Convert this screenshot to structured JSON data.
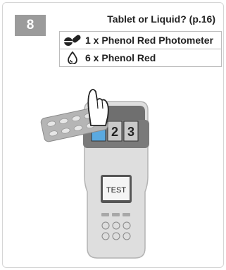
{
  "step": {
    "number": "8"
  },
  "header": {
    "title": "Tablet or Liquid? (p.16)"
  },
  "reagents": [
    {
      "icon": "tablet-icon",
      "text": "1 x Phenol Red Photometer"
    },
    {
      "icon": "drop-icon",
      "text": "6 x Phenol Red"
    }
  ],
  "illustration": {
    "display_text": "TEST",
    "cell_labels": [
      "2",
      "3"
    ],
    "icons": [
      "hand-icon",
      "blister-pack-icon",
      "photometer-icon"
    ]
  },
  "colors": {
    "badge": "#9b9b9b",
    "highlight_cell": "#5aa9e0",
    "device_dark": "#6f6f6f"
  }
}
